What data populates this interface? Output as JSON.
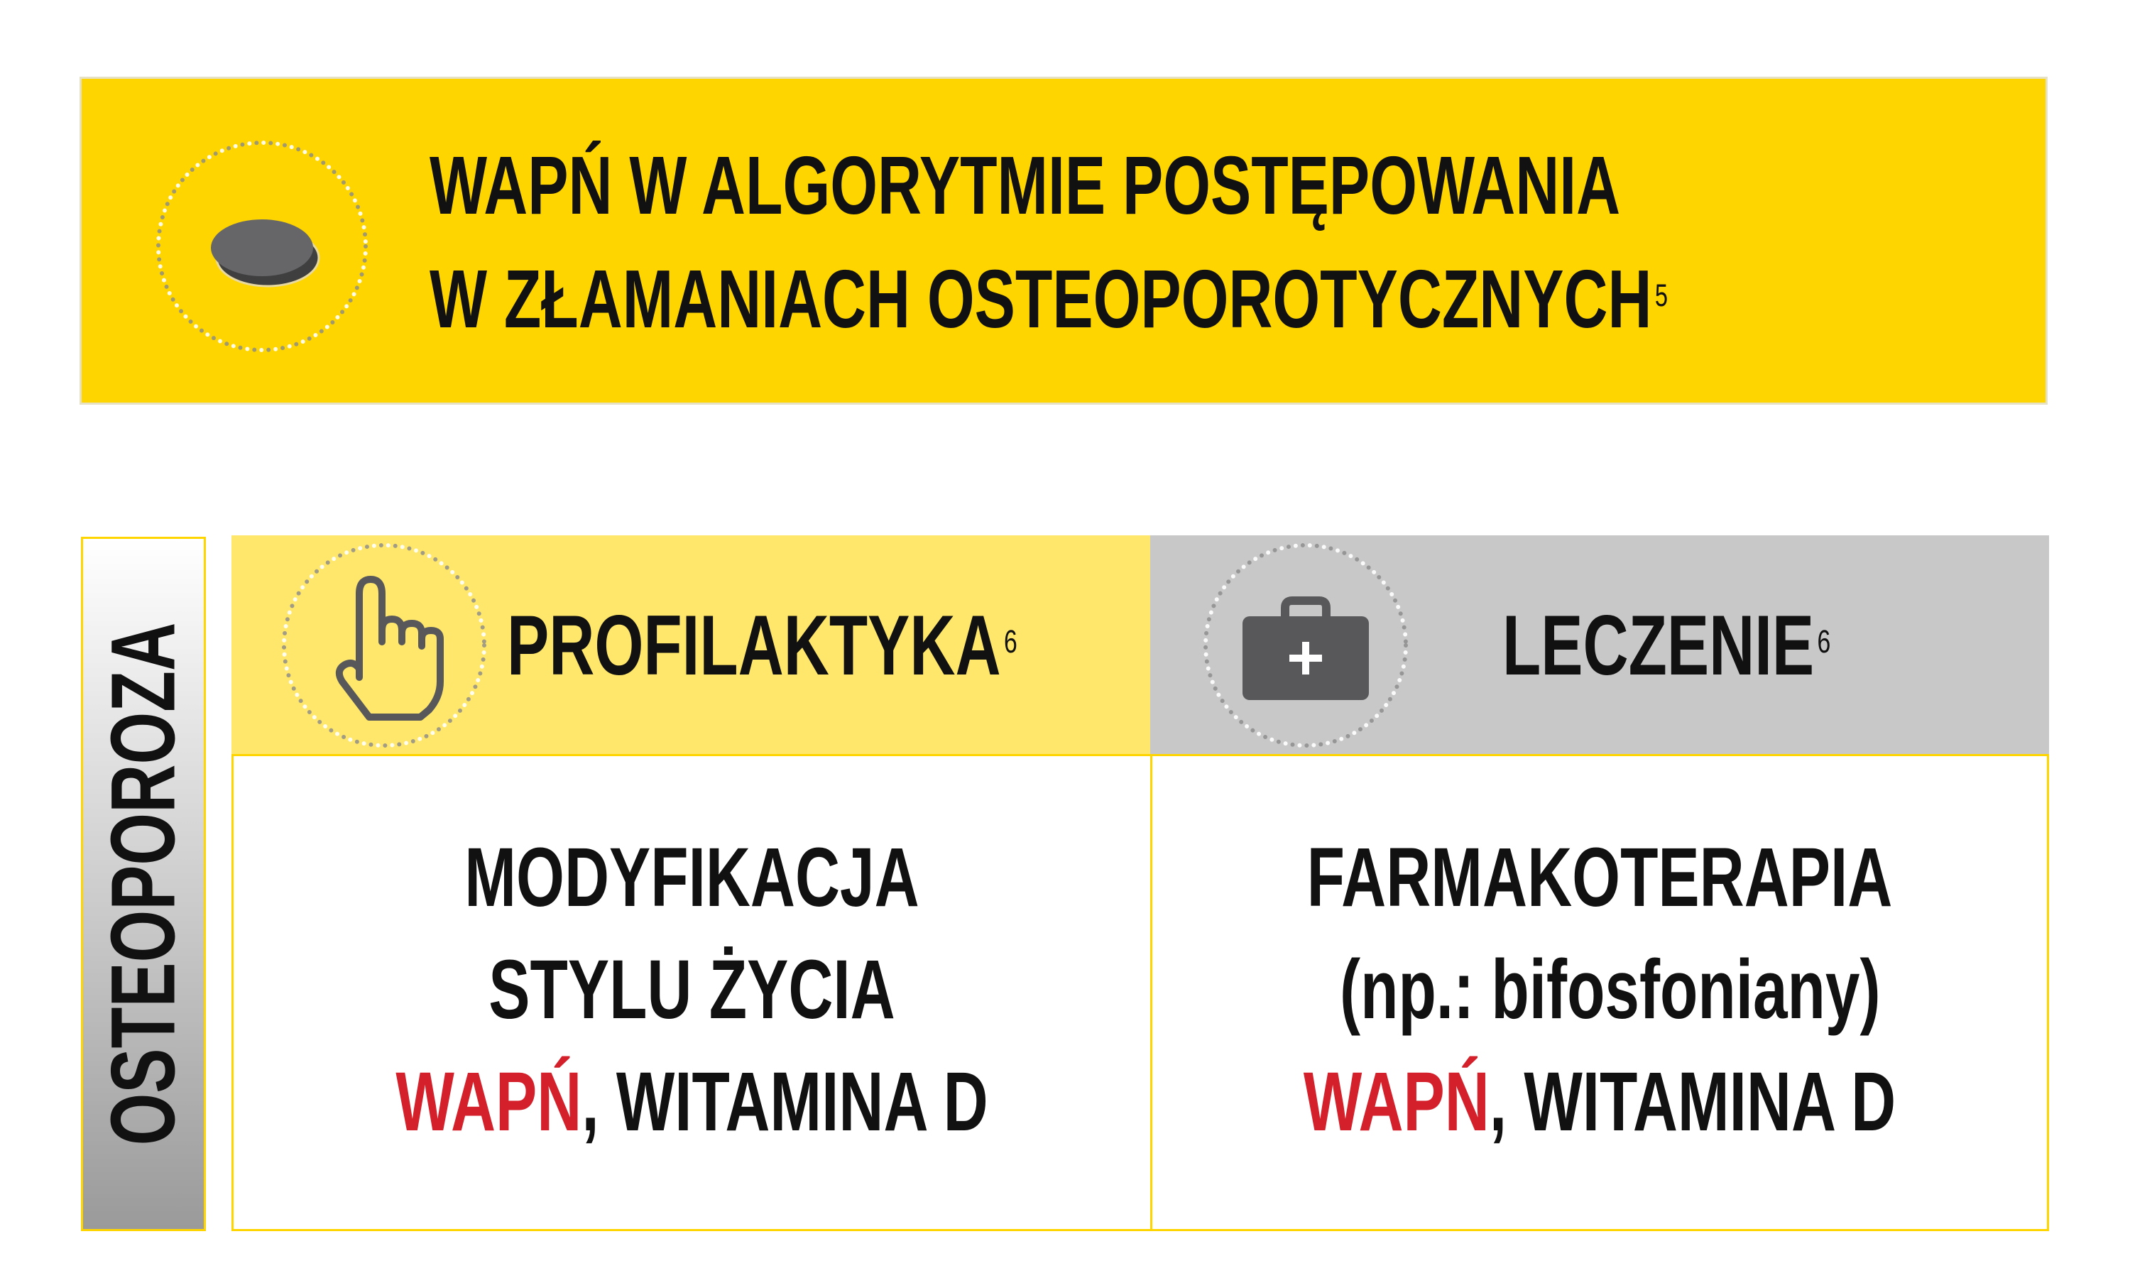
{
  "banner": {
    "title_line1": "WAPŃ W ALGORYTMIE POSTĘPOWANIA",
    "title_line2": "W ZŁAMANIACH OSTEOPOROTYCZNYCH",
    "title_ref": "5",
    "icon": "tablet-pill-icon"
  },
  "side_label": "OSTEOPOROZA",
  "columns": [
    {
      "header": "PROFILAKTYKA",
      "header_ref": "6",
      "icon": "pointing-hand-icon",
      "lines": [
        "MODYFIKACJA",
        "STYLU ŻYCIA"
      ],
      "highlight": "WAPŃ",
      "rest": ", WITAMINA D"
    },
    {
      "header": "LECZENIE",
      "header_ref": "6",
      "icon": "medical-kit-icon",
      "lines": [
        "FARMAKOTERAPIA",
        "(np.: bifosfoniany)"
      ],
      "highlight": "WAPŃ",
      "rest": ", WITAMINA D"
    }
  ],
  "colors": {
    "banner_bg": "#ffd500",
    "left_header_bg": "#ffe76b",
    "right_header_bg": "#c8c8c8",
    "border": "#ffd500",
    "highlight": "#d4202a",
    "text": "#111111",
    "icon_gray": "#58585a"
  }
}
